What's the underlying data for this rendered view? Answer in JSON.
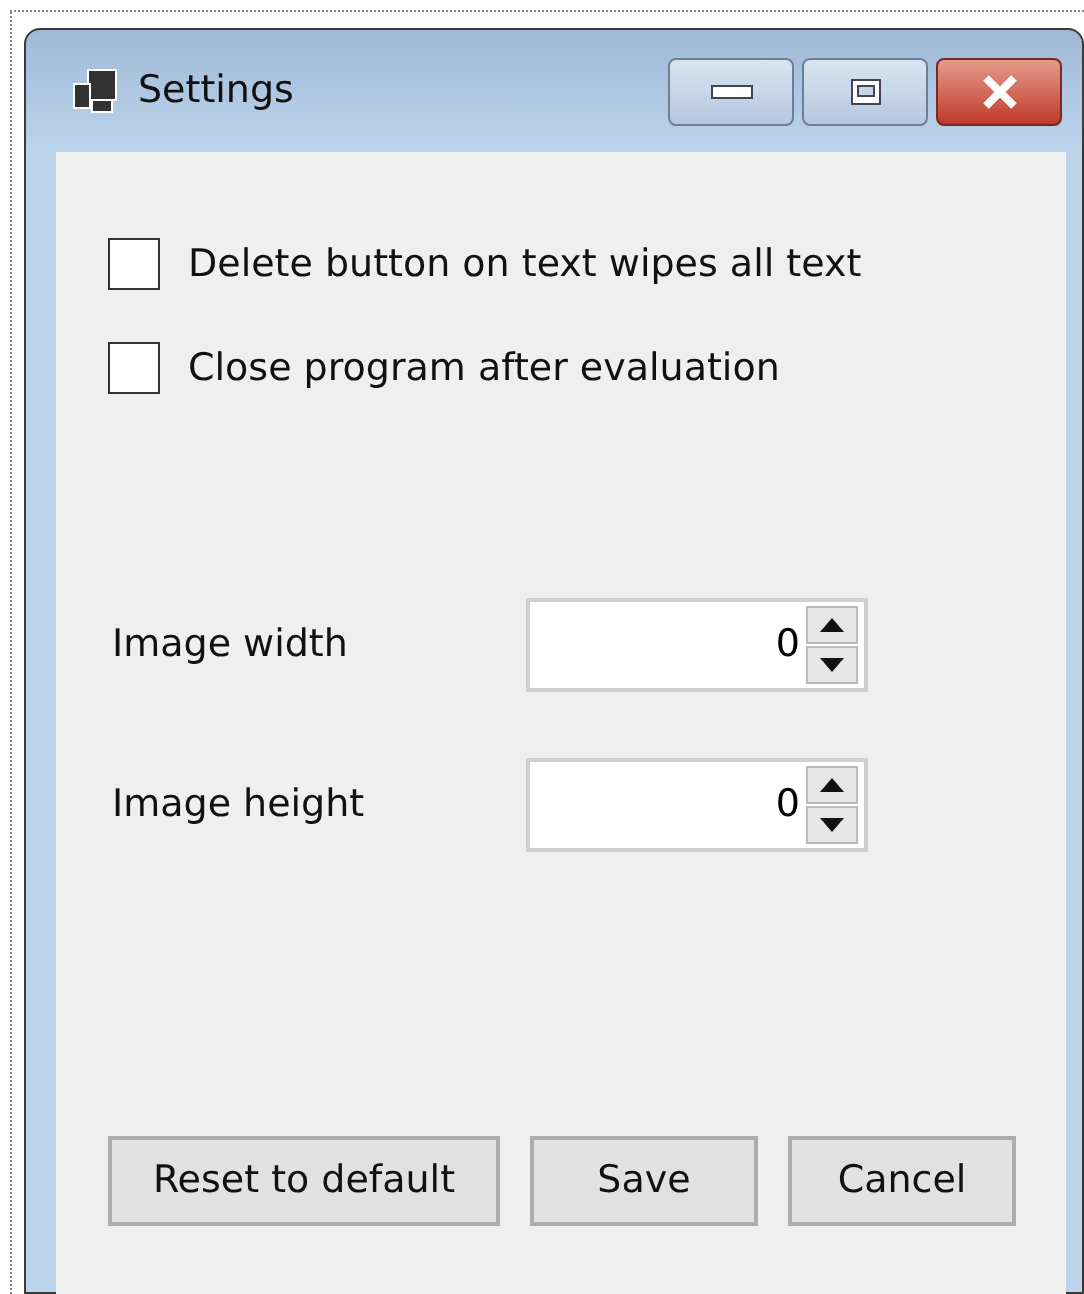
{
  "window": {
    "title": "Settings"
  },
  "checkboxes": [
    {
      "label": "Delete button on text wipes all text",
      "checked": false
    },
    {
      "label": "Close program after evaluation",
      "checked": false
    }
  ],
  "fields": [
    {
      "label": "Image width",
      "value": "0"
    },
    {
      "label": "Image height",
      "value": "0"
    }
  ],
  "buttons": [
    "Reset to default",
    "Save",
    "Cancel"
  ]
}
